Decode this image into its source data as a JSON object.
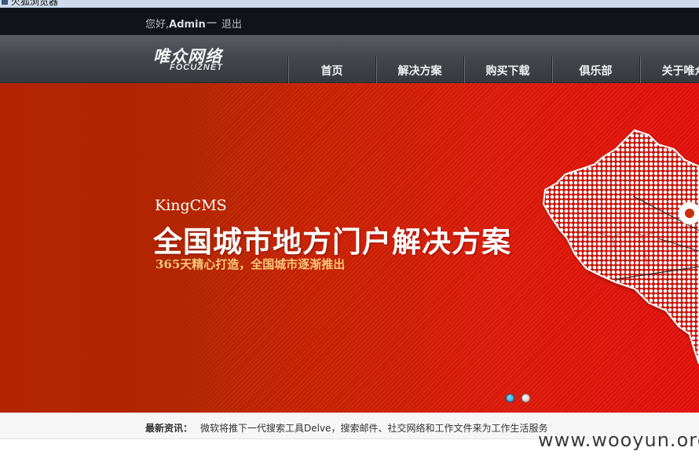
{
  "window": {
    "title": "火狐浏览器"
  },
  "topbar": {
    "greeting_prefix": "您好,",
    "username": "Admin",
    "separator": "一",
    "logout_label": "退出"
  },
  "nav": {
    "logo_cn": "唯众网络",
    "logo_en": "FOCUZNET",
    "items": [
      {
        "label": "首页"
      },
      {
        "label": "解决方案"
      },
      {
        "label": "购买下载"
      },
      {
        "label": "俱乐部"
      },
      {
        "label": "关于唯众"
      }
    ]
  },
  "banner": {
    "subtitle": "KingCMS",
    "title": "全国城市地方门户解决方案",
    "slogan": "365天精心打造，全国城市逐渐推出",
    "map_icon": "china-map-image",
    "slide_count": 2,
    "active_slide": 1,
    "colors": {
      "primary": "#b32300",
      "highlight": "#f6c879",
      "active_dot": "#1a8fd0"
    }
  },
  "news": {
    "label": "最新资讯：",
    "headline": "微软将推下一代搜索工具Delve，搜索邮件、社交网络和工作文件来为工作生活服务"
  },
  "watermark": "www.wooyun.org"
}
